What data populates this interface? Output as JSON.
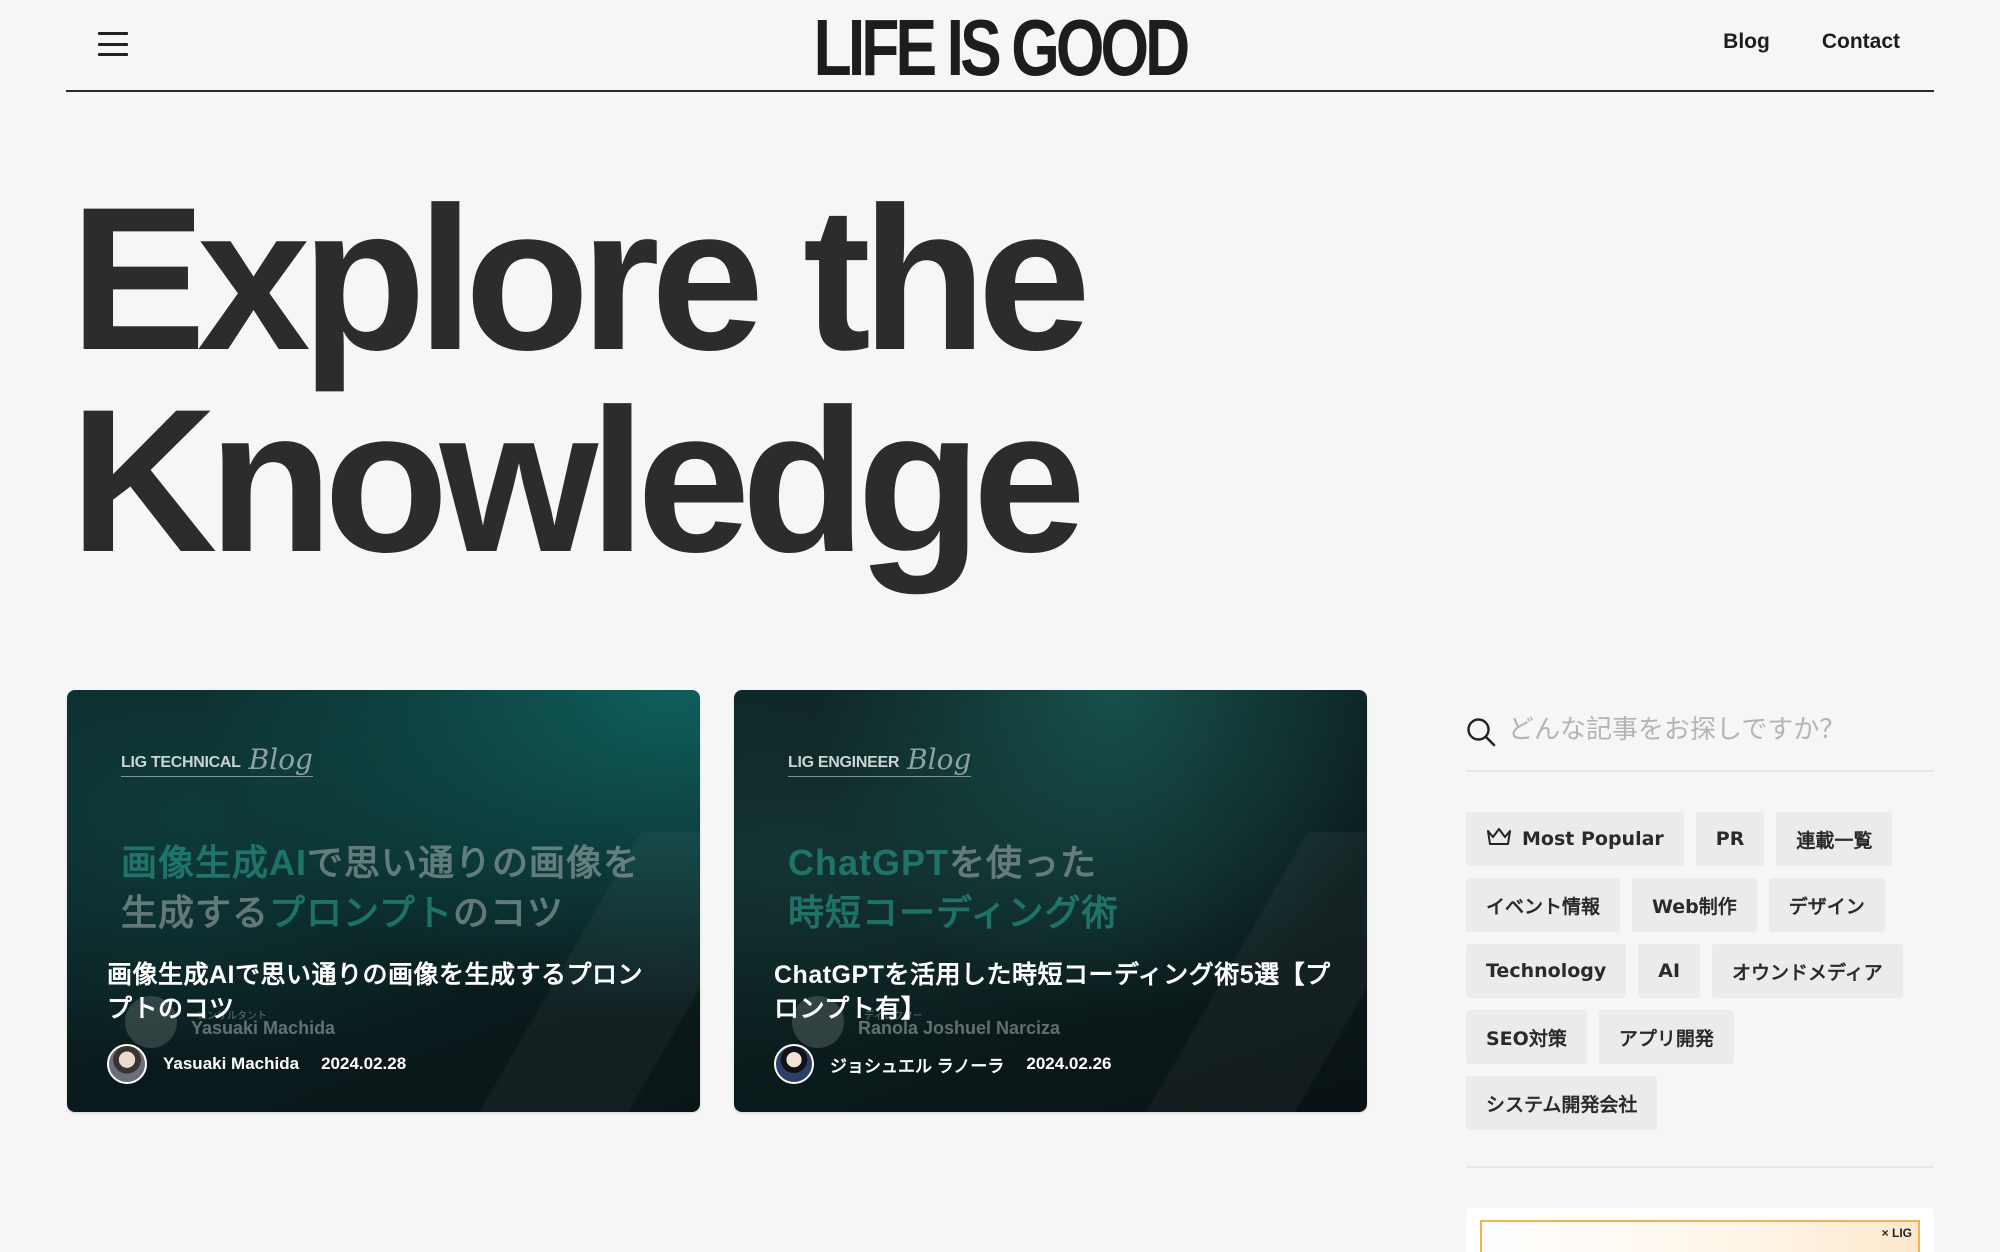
{
  "header": {
    "logo": "LIFE IS GOOD",
    "nav": [
      {
        "label": "Blog"
      },
      {
        "label": "Contact"
      }
    ]
  },
  "hero": {
    "line1": "Explore the",
    "line2": "Knowledge"
  },
  "cards": [
    {
      "brand": "LIG TECHNICAL",
      "brand_script": "Blog",
      "headline_pre_hl": "画像生成AI",
      "headline_mid": "で思い通りの画像を",
      "headline_line2_pre": "生成する",
      "headline_line2_hl": "プロンプト",
      "headline_line2_post": "のコツ",
      "ghost_role": "コンサルタント",
      "ghost_name": "Yasuaki Machida",
      "title": "画像生成AIで思い通りの画像を生成するプロンプトのコツ",
      "author": "Yasuaki Machida",
      "date": "2024.02.28"
    },
    {
      "brand": "LIG ENGINEER",
      "brand_script": "Blog",
      "headline_line1_hl": "ChatGPT",
      "headline_line1_post": "を使った",
      "headline_line2_hl": "時短コーディング術",
      "ghost_role": "ディレクター",
      "ghost_name": "Ranola Joshuel Narciza",
      "title": "ChatGPTを活用した時短コーディング術5選【プロンプト有】",
      "author": "ジョシュエル ラノーラ",
      "date": "2024.02.26"
    }
  ],
  "search": {
    "placeholder": "どんな記事をお探しですか？"
  },
  "tags": [
    {
      "label": "Most Popular",
      "icon": "crown-icon"
    },
    {
      "label": "PR"
    },
    {
      "label": "連載一覧"
    },
    {
      "label": "イベント情報"
    },
    {
      "label": "Web制作"
    },
    {
      "label": "デザイン"
    },
    {
      "label": "Technology"
    },
    {
      "label": "AI"
    },
    {
      "label": "オウンドメディア"
    },
    {
      "label": "SEO対策"
    },
    {
      "label": "アプリ開発"
    },
    {
      "label": "システム開発会社"
    }
  ],
  "ad": {
    "logos": "× LIG"
  },
  "colors": {
    "background": "#f6f6f6",
    "text": "#222222",
    "tag_bg": "#ebebeb",
    "card_dark": "#0d2a2b",
    "card_accent": "#289687"
  }
}
